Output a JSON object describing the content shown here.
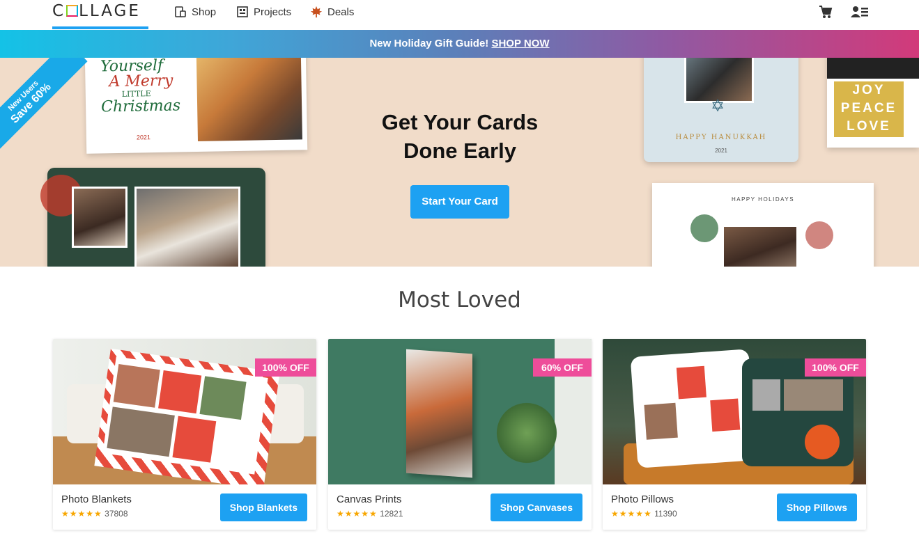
{
  "nav": {
    "logo": "COLLAGE",
    "items": [
      {
        "label": "Shop",
        "icon": "mobile-icon"
      },
      {
        "label": "Projects",
        "icon": "projects-icon"
      },
      {
        "label": "Deals",
        "icon": "maple-leaf-icon"
      }
    ],
    "cart_icon": "cart-icon",
    "account_icon": "account-icon"
  },
  "promo": {
    "text": "New Holiday Gift Guide!",
    "link": "SHOP NOW"
  },
  "hero": {
    "corner_line1": "New Users",
    "corner_line2": "Save 60%",
    "title_line1": "Get Your Cards",
    "title_line2": "Done Early",
    "button": "Start Your Card",
    "card_texts": {
      "c1_line1": "Yourself",
      "c1_line2": "A Merry",
      "c1_line3": "LITTLE",
      "c1_line4": "Christmas",
      "c1_year": "2021",
      "hanukkah": "HAPPY HANUKKAH",
      "hanukkah_year": "2021",
      "joy": "JOY",
      "peace": "PEACE",
      "love": "LOVE",
      "holidays": "HAPPY HOLIDAYS"
    }
  },
  "section_title": "Most Loved",
  "products": [
    {
      "name": "Photo Blankets",
      "reviews": "37808",
      "badge": "100% OFF",
      "button": "Shop Blankets",
      "rating": 5
    },
    {
      "name": "Canvas Prints",
      "reviews": "12821",
      "badge": "60% OFF",
      "button": "Shop Canvases",
      "rating": 5
    },
    {
      "name": "Photo Pillows",
      "reviews": "11390",
      "badge": "100% OFF",
      "button": "Shop Pillows",
      "rating": 5
    }
  ],
  "colors": {
    "accent": "#1da1f2",
    "badge": "#ee4d9a",
    "star": "#f7a600"
  }
}
